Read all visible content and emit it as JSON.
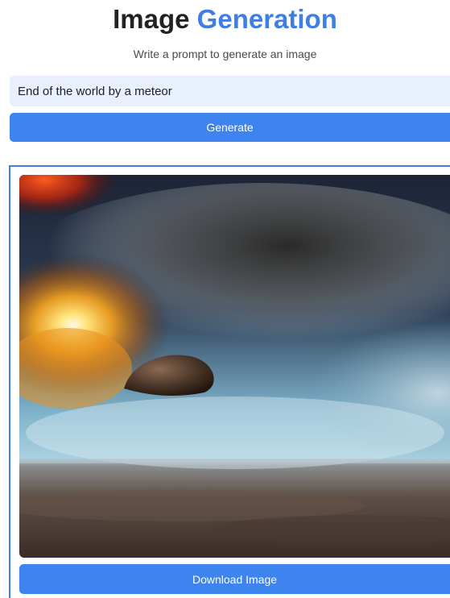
{
  "header": {
    "title_word1": "Image",
    "title_word2": "Generation",
    "subtitle": "Write a prompt to generate an image"
  },
  "prompt": {
    "value": "End of the world by a meteor"
  },
  "actions": {
    "generate_label": "Generate",
    "download_label": "Download Image"
  },
  "colors": {
    "accent": "#3f7ee4",
    "button": "#3e84ee",
    "input_background": "#e8f0fe"
  }
}
